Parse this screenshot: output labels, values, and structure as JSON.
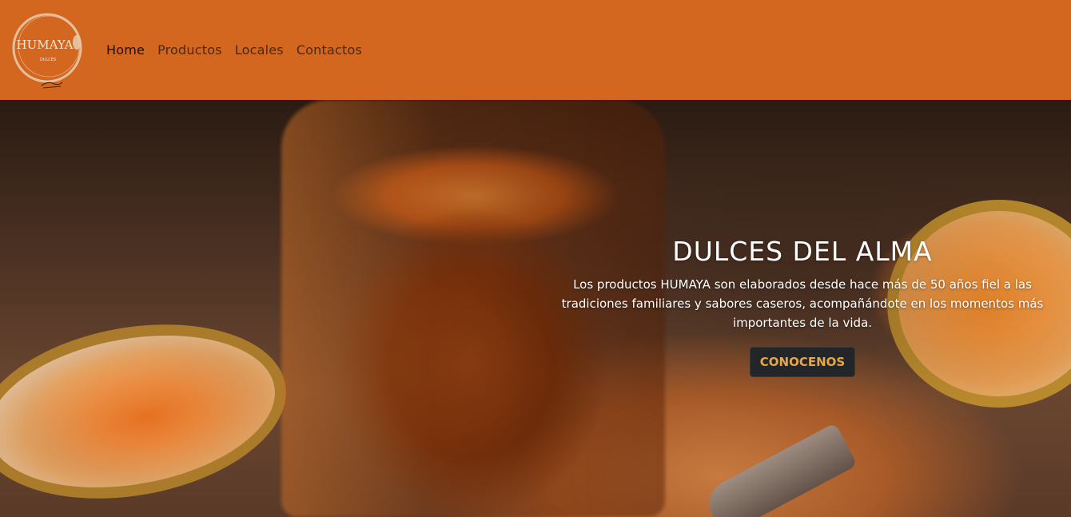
{
  "brand": {
    "logo_name": "HUMAYA",
    "logo_sub": "DULCES"
  },
  "nav": {
    "items": [
      {
        "label": "Home"
      },
      {
        "label": "Productos"
      },
      {
        "label": "Locales"
      },
      {
        "label": "Contactos"
      }
    ]
  },
  "hero": {
    "title": "DULCES DEL ALMA",
    "text": "Los productos HUMAYA son elaborados desde hace más de 50 años fiel a las tradiciones familiares y sabores caseros, acompañándote en los momentos más importantes de la vida.",
    "button_label": "CONOCENOS"
  },
  "colors": {
    "navbar": "#d4671f",
    "button_bg": "#222629",
    "button_text": "#e8a646"
  }
}
